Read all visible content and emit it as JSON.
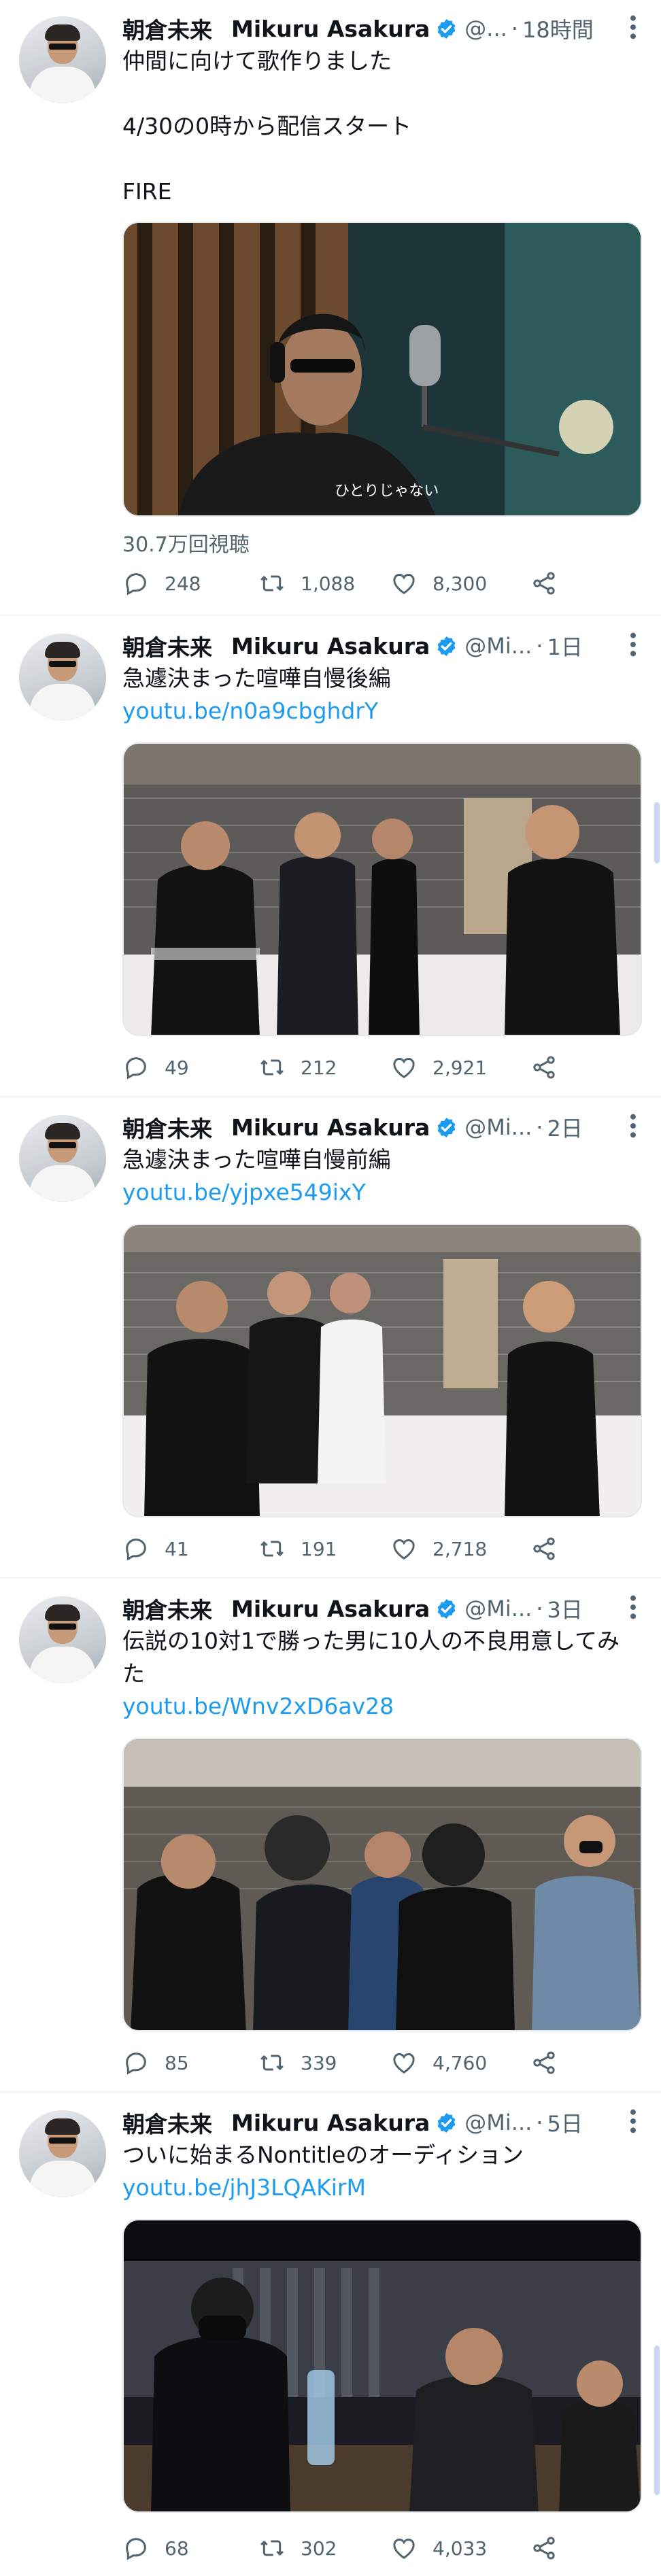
{
  "tweets": [
    {
      "name": "朝倉未来",
      "display_name": "Mikuru Asakura",
      "handle": "@...",
      "time": "18時間",
      "text": "仲間に向けて歌作りました\n\n4/30の0時から配信スタート\n\nFIRE",
      "link": "",
      "media_caption": "ひとりじゃない",
      "views": "30.7万回視聴",
      "replies": "248",
      "retweets": "1,088",
      "likes": "8,300"
    },
    {
      "name": "朝倉未来",
      "display_name": "Mikuru Asakura",
      "handle": "@Mi...",
      "time": "1日",
      "text": "急遽決まった喧嘩自慢後編",
      "link": "youtu.be/n0a9cbghdrY",
      "media_caption": "",
      "views": "",
      "replies": "49",
      "retweets": "212",
      "likes": "2,921"
    },
    {
      "name": "朝倉未来",
      "display_name": "Mikuru Asakura",
      "handle": "@Mi...",
      "time": "2日",
      "text": "急遽決まった喧嘩自慢前編",
      "link": "youtu.be/yjpxe549ixY",
      "media_caption": "",
      "views": "",
      "replies": "41",
      "retweets": "191",
      "likes": "2,718"
    },
    {
      "name": "朝倉未来",
      "display_name": "Mikuru Asakura",
      "handle": "@Mi...",
      "time": "3日",
      "text": "伝説の10対1で勝った男に10人の不良用意してみた",
      "link": "youtu.be/Wnv2xD6av28",
      "media_caption": "",
      "views": "",
      "replies": "85",
      "retweets": "339",
      "likes": "4,760"
    },
    {
      "name": "朝倉未来",
      "display_name": "Mikuru Asakura",
      "handle": "@Mi...",
      "time": "5日",
      "text": "ついに始まるNontitleのオーディション",
      "link": "youtu.be/jhJ3LQAKirM",
      "media_caption": "",
      "views": "",
      "replies": "68",
      "retweets": "302",
      "likes": "4,033"
    }
  ],
  "colors": {
    "link": "#1d9bf0",
    "verified": "#1d9bf0",
    "secondary_text": "#536471"
  }
}
